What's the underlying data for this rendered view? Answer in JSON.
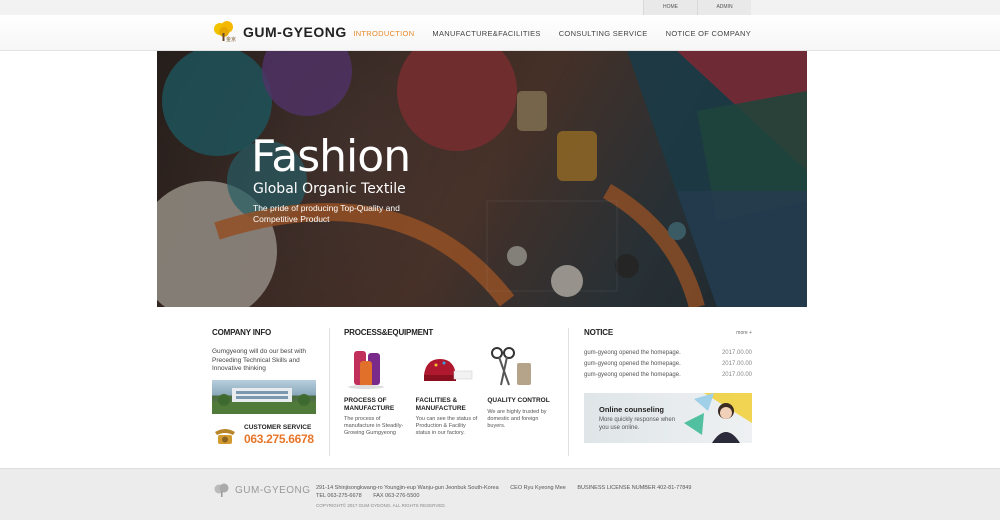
{
  "util": {
    "home": "HOME",
    "admin": "ADMIN"
  },
  "brand": {
    "name": "GUM-GYEONG",
    "logo_caption": "金京"
  },
  "nav": {
    "introduction": "INTRODUCTION",
    "manufacture": "MANUFACTURE&FACILITIES",
    "consulting": "CONSULTING SERVICE",
    "notice": "NOTICE OF COMPANY"
  },
  "hero": {
    "title": "Fashion",
    "subtitle": "Global Organic Textile",
    "description": "The pride of producing Top-Quality and Competitive Product"
  },
  "company_info": {
    "title": "COMPANY INFO",
    "description": "Gumgyeong will do our best with Preceding Technical Skills and Innovative thinking",
    "cs_label": "CUSTOMER SERVICE",
    "cs_number": "063.275.6678"
  },
  "process": {
    "title": "PROCESS&EQUIPMENT",
    "items": [
      {
        "name": "PROCESS OF MANUFACTURE",
        "desc": "The process of manufacture in Steadily-Growing Gumgyeong"
      },
      {
        "name": "FACILITIES & MANUFACTURE",
        "desc": "You can see the status of Production & Facility status in our factory."
      },
      {
        "name": "QUALITY CONTROL",
        "desc": "We are highly trusted by domestic and foreign buyers."
      }
    ]
  },
  "notice": {
    "title": "NOTICE",
    "more": "more +",
    "rows": [
      {
        "text": "gum-gyeong opened the homepage.",
        "date": "2017.00.00"
      },
      {
        "text": "gum-gyeong opened the homepage.",
        "date": "2017.00.00"
      },
      {
        "text": "gum-gyeong opened the homepage.",
        "date": "2017.00.00"
      }
    ],
    "counsel_title": "Online counseling",
    "counsel_desc": "More quickly response when you use online."
  },
  "footer": {
    "logo": "GUM-GYEONG",
    "address": "291-14 Shinjisongkwang-ro Youngjin-eup Wanju-gun Jeonbuk South-Korea",
    "ceo": "CEO Ryu Kyeong Mee",
    "license": "BUSINESS LICENSE NUMBER 402-81-77849",
    "tel": "TEL 063-275-6678",
    "fax": "FAX 063-276-5500",
    "copyright": "COPYRIGHT© 2017 GUM-GYEONG. ALL RIGHTS RESERVED."
  },
  "colors": {
    "accent": "#e8892a",
    "phone_number": "#e8762a"
  },
  "icons": {
    "logo": "tree-logo-icon",
    "phone": "phone-icon",
    "more": "plus-icon"
  }
}
